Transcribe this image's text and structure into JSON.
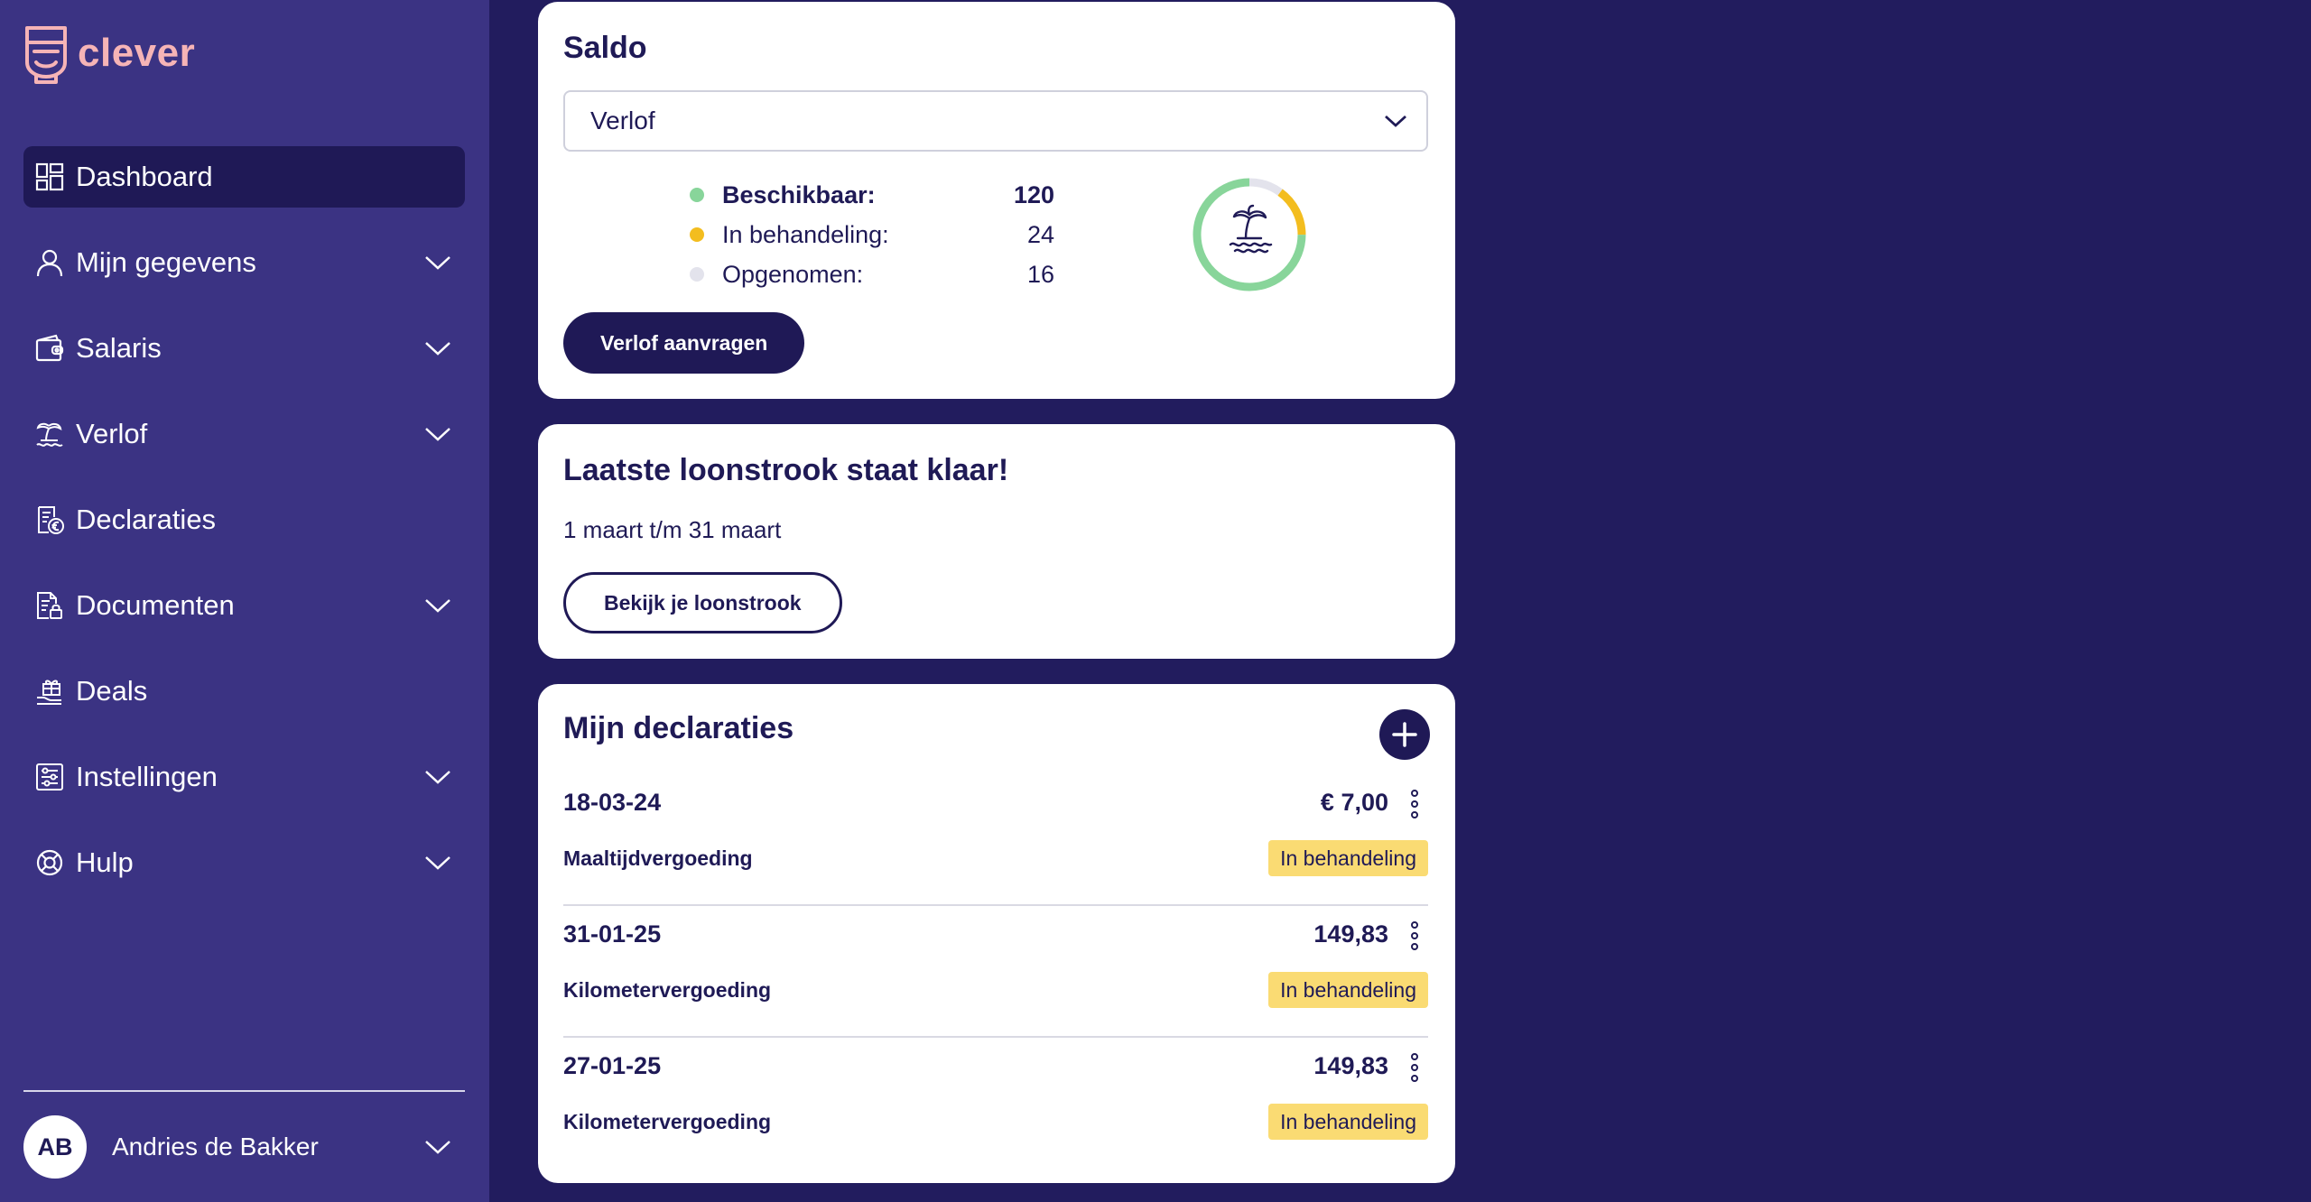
{
  "brand": {
    "name": "clever",
    "color": "#f6b4b6"
  },
  "sidebar": {
    "items": [
      {
        "label": "Dashboard",
        "icon": "dashboard-icon",
        "active": true,
        "expandable": false
      },
      {
        "label": "Mijn gegevens",
        "icon": "user-icon",
        "expandable": true
      },
      {
        "label": "Salaris",
        "icon": "wallet-icon",
        "expandable": true
      },
      {
        "label": "Verlof",
        "icon": "island-icon",
        "expandable": true
      },
      {
        "label": "Declaraties",
        "icon": "receipt-euro-icon",
        "expandable": false
      },
      {
        "label": "Documenten",
        "icon": "document-lock-icon",
        "expandable": true
      },
      {
        "label": "Deals",
        "icon": "gift-hand-icon",
        "expandable": false
      },
      {
        "label": "Instellingen",
        "icon": "settings-sliders-icon",
        "expandable": true
      },
      {
        "label": "Hulp",
        "icon": "lifebuoy-icon",
        "expandable": true
      }
    ],
    "user": {
      "initials": "AB",
      "name": "Andries de Bakker"
    }
  },
  "saldo": {
    "title": "Saldo",
    "selected_type": "Verlof",
    "legend": [
      {
        "label": "Beschikbaar:",
        "value": "120",
        "color": "#88d59a"
      },
      {
        "label": "In behandeling:",
        "value": "24",
        "color": "#f3bd1f"
      },
      {
        "label": "Opgenomen:",
        "value": "16",
        "color": "#e3e3ec"
      }
    ],
    "button_label": "Verlof aanvragen"
  },
  "loonstrook": {
    "title": "Laatste loonstrook staat klaar!",
    "period": "1 maart t/m 31 maart",
    "button_label": "Bekijk je loonstrook"
  },
  "declaraties": {
    "title": "Mijn declaraties",
    "rows": [
      {
        "date": "18-03-24",
        "amount": "€ 7,00",
        "type": "Maaltijdvergoeding",
        "status": "In behandeling"
      },
      {
        "date": "31-01-25",
        "amount": "149,83",
        "type": "Kilometervergoeding",
        "status": "In behandeling"
      },
      {
        "date": "27-01-25",
        "amount": "149,83",
        "type": "Kilometervergoeding",
        "status": "In behandeling"
      }
    ],
    "status_color": "#fadb73"
  },
  "colors": {
    "background": "#221c5e",
    "sidebar": "#3b3383",
    "active_item": "#1f1956",
    "text_dark": "#1f1a56"
  }
}
